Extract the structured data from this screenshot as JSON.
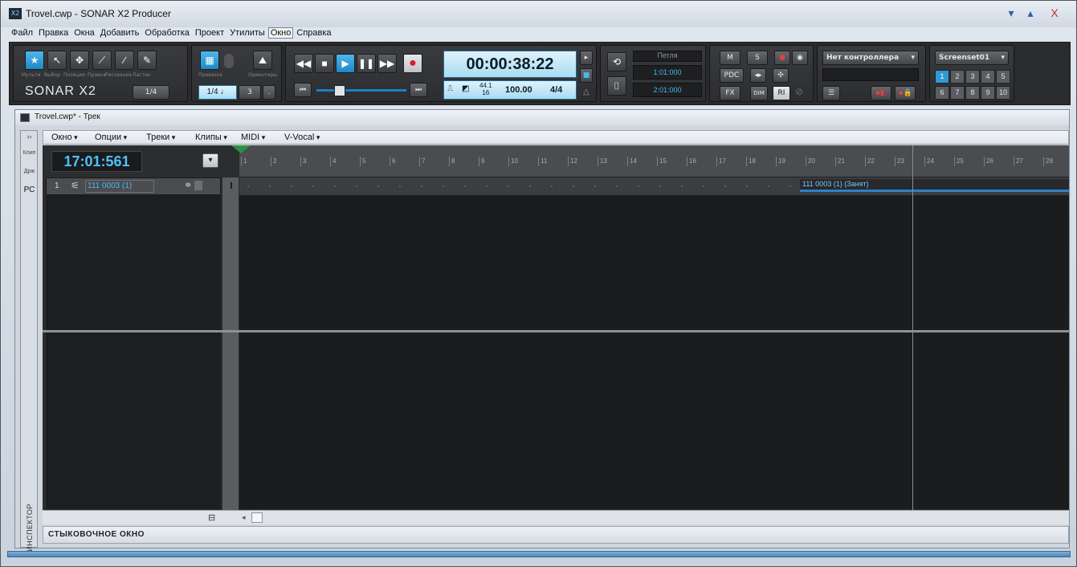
{
  "window": {
    "title": "Trovel.cwp - SONAR X2 Producer",
    "icon_label": "X2",
    "controls": {
      "minimize": "▾",
      "maximize": "▴",
      "close": "X"
    }
  },
  "menu": [
    "Файл",
    "Правка",
    "Окна",
    "Добавить",
    "Обработка",
    "Проект",
    "Утилиты",
    "Окно",
    "Справка"
  ],
  "menu_active_index": 7,
  "toolbar": {
    "tools": {
      "labels": [
        "Мульти",
        "Выбор",
        "Позиция",
        "Правка",
        "Рисование",
        "Ластик"
      ],
      "logo": "SONAR X2",
      "snap_small": "1/4"
    },
    "snap": {
      "label_left": "Привязка",
      "label_right": "Ориентиры",
      "value": "1/4",
      "note": "♩",
      "count": "3",
      "extra": "."
    },
    "transport": {
      "time": "00:00:38:22",
      "sample_rate_top": "44.1",
      "sample_rate_bottom": "16",
      "tempo": "100.00",
      "meter": "4/4"
    },
    "loop": {
      "label": "Петля",
      "start": "1:01:000",
      "end": "2:01:000"
    },
    "mix": {
      "m": "M",
      "s": "S",
      "pdc": "PDC",
      "fx": "FX",
      "dim": "DIM",
      "ri": "RI"
    },
    "controller": {
      "label": "Нет контроллера"
    },
    "screenset": {
      "label": "Screenset01",
      "numbers": [
        "1",
        "2",
        "3",
        "4",
        "5",
        "6",
        "7",
        "8",
        "9",
        "10"
      ],
      "selected": "1"
    }
  },
  "document": {
    "title": "Trovel.cwp* - Трек",
    "left_tabs": [
      "Клип",
      "Држ",
      "РС"
    ],
    "inspector_label": "ИНСПЕКТОР",
    "track_menu": [
      "Окно",
      "Опции",
      "Треки",
      "Клипы",
      "MIDI",
      "V-Vocal"
    ],
    "counter": "17:01:561",
    "ruler_ticks": [
      "1",
      "2",
      "3",
      "4",
      "5",
      "6",
      "7",
      "8",
      "9",
      "10",
      "11",
      "12",
      "13",
      "14",
      "15",
      "16",
      "17",
      "18",
      "19",
      "20",
      "21",
      "22",
      "23",
      "24",
      "25",
      "26",
      "27",
      "28"
    ],
    "track": {
      "number": "1",
      "name": "111 0003 (1)"
    },
    "clip_label": "111 0003 (1) (Занят)",
    "dock_label": "СТЫКОВОЧНОЕ ОКНО"
  }
}
